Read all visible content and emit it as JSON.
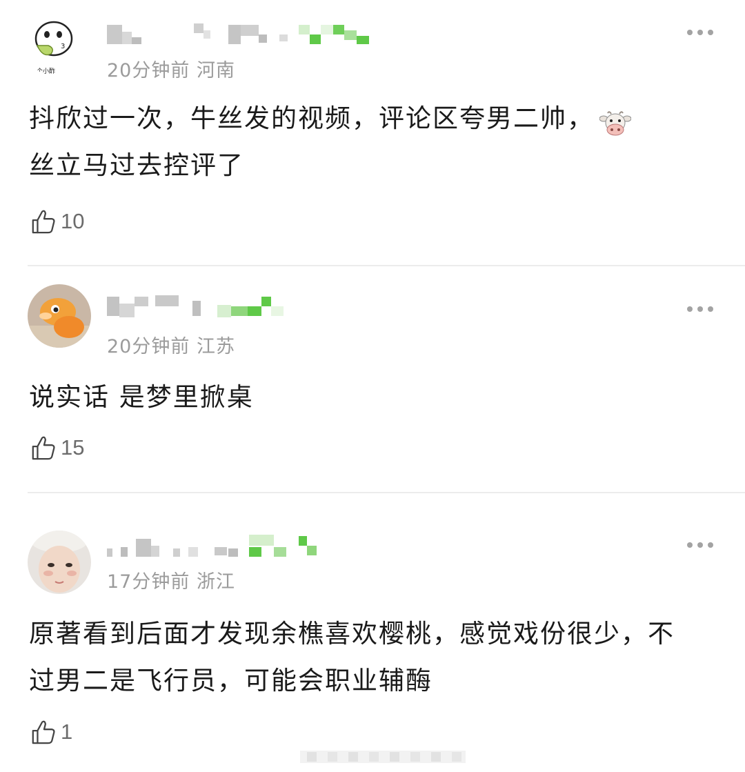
{
  "comments": [
    {
      "meta": "20分钟前 河南",
      "avatar_icon": "meme-avatar-icon",
      "avatar_text": "你个小酢",
      "text_part1": "抖欣过一次，牛丝发的视频，评论区夸男二帅，",
      "text_emoji": "cow-face-icon",
      "text_part2": "丝立马过去控评了",
      "likes": "10"
    },
    {
      "meta": "20分钟前 江苏",
      "avatar_icon": "cartoon-avatar-icon",
      "text": "说实话 是梦里掀桌",
      "likes": "15"
    },
    {
      "meta": "17分钟前 浙江",
      "avatar_icon": "photo-avatar-icon",
      "text": "原著看到后面才发现余樵喜欢樱桃，感觉戏份很少，不过男二是飞行员，可能会职业辅酶",
      "likes": "1"
    }
  ],
  "colors": {
    "meta_gray": "#9b9b9b",
    "divider": "#ececec",
    "badge_green": "#5fc948"
  }
}
